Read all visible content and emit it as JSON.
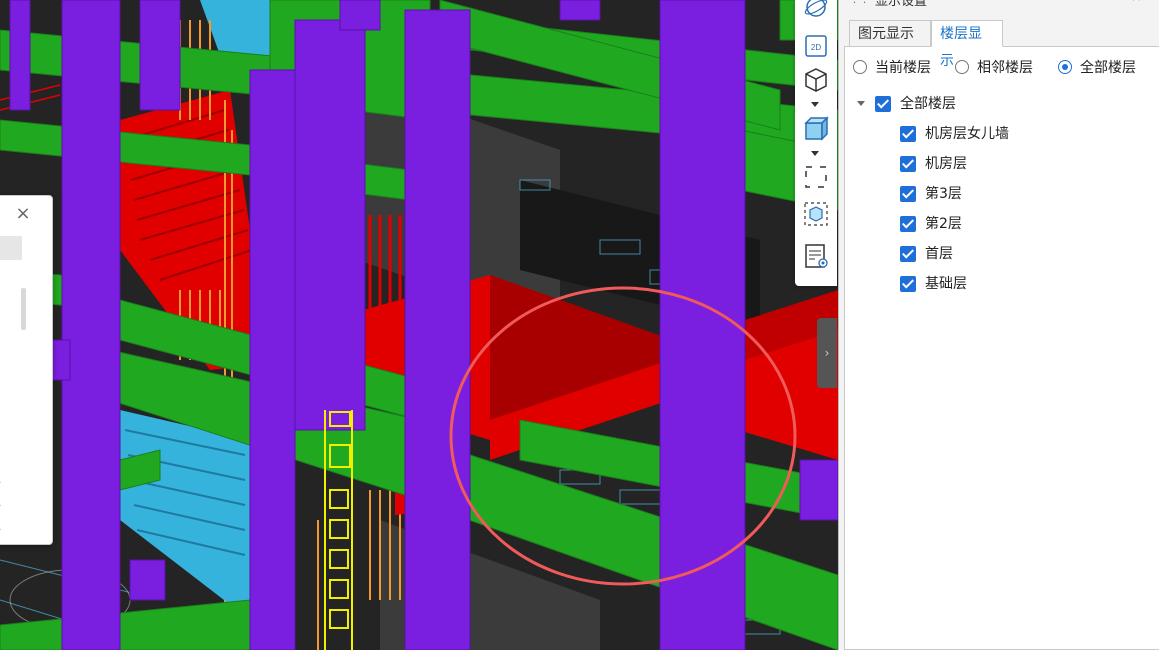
{
  "panel": {
    "title": "显示设置",
    "tabs": [
      {
        "label": "图元显示",
        "active": false
      },
      {
        "label": "楼层显示",
        "active": true
      }
    ],
    "radio_options": [
      {
        "label": "当前楼层",
        "selected": false
      },
      {
        "label": "相邻楼层",
        "selected": false
      },
      {
        "label": "全部楼层",
        "selected": true
      }
    ],
    "tree": {
      "root": {
        "label": "全部楼层",
        "checked": true,
        "expanded": true
      },
      "items": [
        {
          "label": "机房层女儿墙",
          "checked": true
        },
        {
          "label": "机房层",
          "checked": true
        },
        {
          "label": "第3层",
          "checked": true
        },
        {
          "label": "第2层",
          "checked": true
        },
        {
          "label": "首层",
          "checked": true
        },
        {
          "label": "基础层",
          "checked": true
        }
      ]
    }
  },
  "toolbar": {
    "icons": [
      "orbit-icon",
      "view-2d-icon",
      "view-3d-cube-icon",
      "solid-box-icon",
      "dashed-frame-icon",
      "selected-cube-icon",
      "display-settings-icon"
    ],
    "btn_2d_label": "2D"
  },
  "colors": {
    "column": "#7a1fe0",
    "beam": "#21a821",
    "slab_red": "#e00000",
    "stair_blue": "#36b3dc",
    "rail_orange": "#f29a2e",
    "ladder_yellow": "#f0f000",
    "highlight_circle": "#f05a5a",
    "accent_blue": "#1e6fd9"
  }
}
